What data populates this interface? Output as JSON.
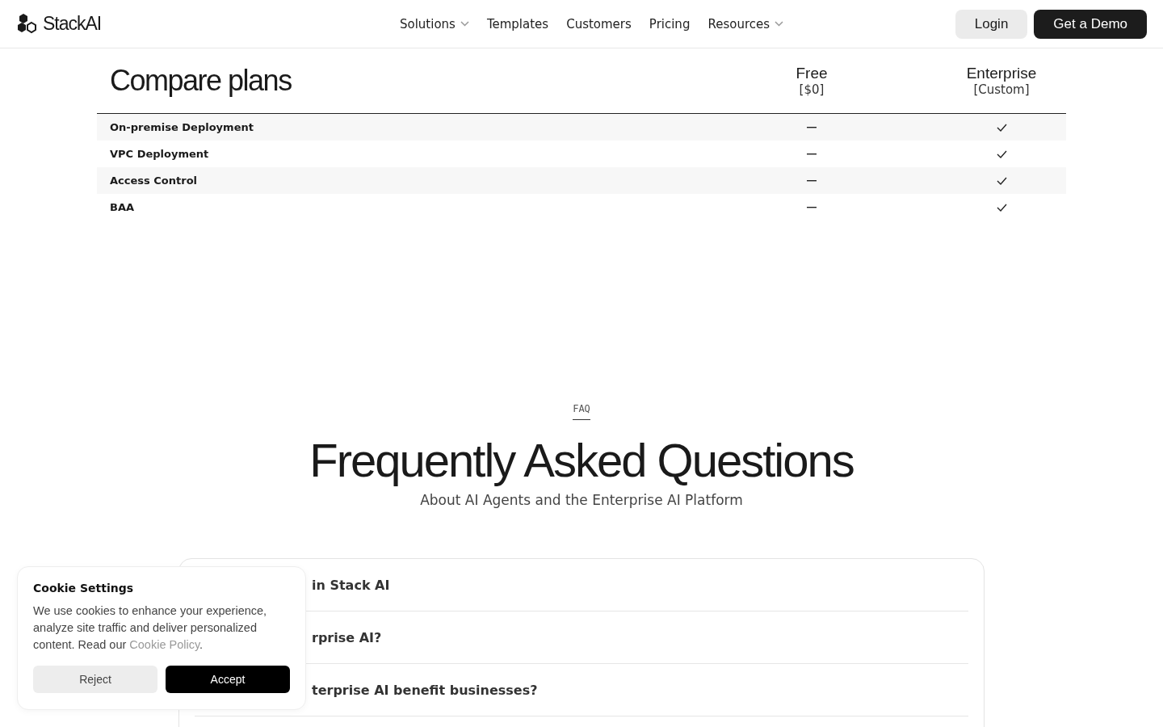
{
  "nav": {
    "logo": "StackAI",
    "links": [
      {
        "label": "Solutions",
        "dropdown": true
      },
      {
        "label": "Templates",
        "dropdown": false
      },
      {
        "label": "Customers",
        "dropdown": false
      },
      {
        "label": "Pricing",
        "dropdown": false
      },
      {
        "label": "Resources",
        "dropdown": true
      }
    ],
    "login": "Login",
    "demo": "Get a Demo"
  },
  "compare": {
    "title": "Compare plans",
    "plans": [
      {
        "name": "Free",
        "price": "[$0]"
      },
      {
        "name": "Enterprise",
        "price": "[Custom]"
      }
    ],
    "rows": [
      {
        "feature": "On-premise Deployment",
        "free": false,
        "enterprise": true
      },
      {
        "feature": "VPC Deployment",
        "free": false,
        "enterprise": true
      },
      {
        "feature": "Access Control",
        "free": false,
        "enterprise": true
      },
      {
        "feature": "BAA",
        "free": false,
        "enterprise": true
      }
    ]
  },
  "faq": {
    "eyebrow": "FAQ",
    "title": "Frequently Asked Questions",
    "subtitle": "About AI Agents and the Enterprise AI Platform",
    "questions": [
      "in Stack AI",
      "rprise AI?",
      "terprise AI benefit businesses?"
    ]
  },
  "cookie": {
    "title": "Cookie Settings",
    "text": "We use cookies to enhance your experience, analyze site traffic and deliver personalized content. Read our ",
    "link": "Cookie Policy",
    "after": ".",
    "reject": "Reject",
    "accept": "Accept"
  }
}
